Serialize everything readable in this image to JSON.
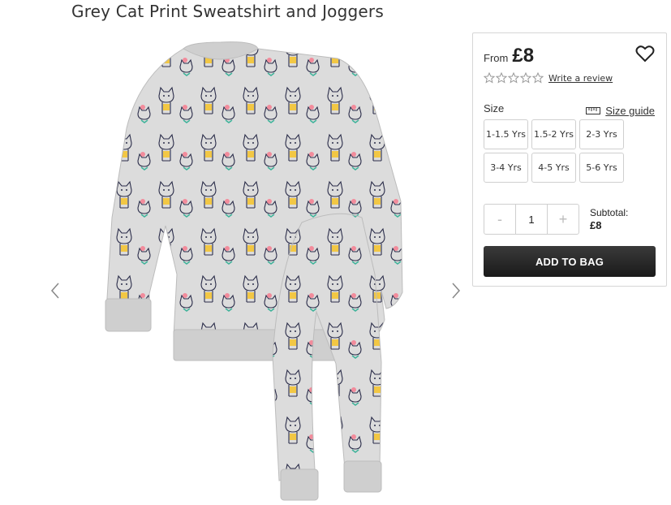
{
  "product": {
    "title": "Grey Cat Print Sweatshirt and Joggers",
    "image_alt": "Grey cat print sweatshirt and joggers set"
  },
  "gallery": {
    "prev_icon": "chevron-left-icon",
    "next_icon": "chevron-right-icon"
  },
  "pricing": {
    "from_label": "From",
    "price": "£8"
  },
  "rating": {
    "stars": 5,
    "filled": 0,
    "review_link": "Write a review"
  },
  "size": {
    "label": "Size",
    "guide_label": "Size guide",
    "options": [
      "1-1.5 Yrs",
      "1.5-2 Yrs",
      "2-3 Yrs",
      "3-4 Yrs",
      "4-5 Yrs",
      "5-6 Yrs"
    ]
  },
  "quantity": {
    "minus": "-",
    "value": "1",
    "plus": "+"
  },
  "subtotal": {
    "label": "Subtotal:",
    "amount": "£8"
  },
  "actions": {
    "add_to_bag": "ADD TO BAG"
  },
  "colors": {
    "button_dark": "#1a1a1a",
    "border": "#d6d6d6",
    "fabric_grey": "#d9d9d9"
  }
}
